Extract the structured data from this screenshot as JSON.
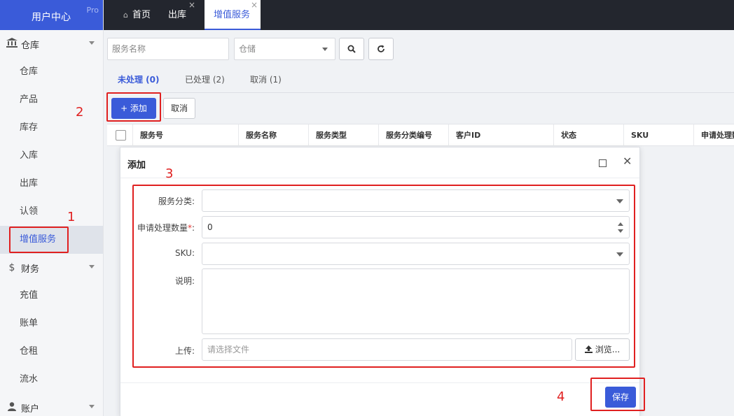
{
  "brand": {
    "title": "用户中心",
    "badge": "Pro"
  },
  "sidebar": {
    "groups": [
      {
        "label": "仓库",
        "icon": "bank-icon",
        "items": [
          "仓库",
          "产品",
          "库存",
          "入库",
          "出库",
          "认领",
          "增值服务"
        ]
      },
      {
        "label": "财务",
        "icon": "dollar-icon",
        "items": [
          "充值",
          "账单",
          "仓租",
          "流水"
        ]
      },
      {
        "label": "账户",
        "icon": "user-icon",
        "items": []
      }
    ],
    "active_item": "增值服务"
  },
  "topbar": {
    "tabs": [
      {
        "label": "首页",
        "icon": "home-icon"
      },
      {
        "label": "出库",
        "close": "×"
      },
      {
        "label": "增值服务",
        "close": "×",
        "active": true
      }
    ]
  },
  "search": {
    "service_name_placeholder": "服务名称",
    "warehouse_select": "仓储",
    "search_icon": "search-icon",
    "refresh_icon": "refresh-icon"
  },
  "status_tabs": [
    {
      "label": "未处理 (0)",
      "active": true
    },
    {
      "label": "已处理 (2)"
    },
    {
      "label": "取消 (1)"
    }
  ],
  "actions": {
    "add_label": "+ 添加",
    "cancel_label": "取消"
  },
  "table": {
    "columns": [
      "服务号",
      "服务名称",
      "服务类型",
      "服务分类编号",
      "客户ID",
      "状态",
      "SKU",
      "申请处理数量"
    ]
  },
  "dialog": {
    "title": "添加",
    "fields": {
      "category_label": "服务分类:",
      "category_value": "",
      "quantity_label": "申请处理数量",
      "quantity_required": "*",
      "quantity_colon": ":",
      "quantity_value": "0",
      "sku_label": "SKU:",
      "sku_value": "",
      "desc_label": "说明:",
      "upload_label": "上传:",
      "upload_placeholder": "请选择文件",
      "browse_label": "浏览..."
    },
    "save_label": "保存"
  },
  "annotations": {
    "n1": "1",
    "n2": "2",
    "n3": "3",
    "n4": "4"
  },
  "colors": {
    "primary": "#3a5bd9",
    "topbar": "#23262e",
    "annotation": "#e02020"
  }
}
